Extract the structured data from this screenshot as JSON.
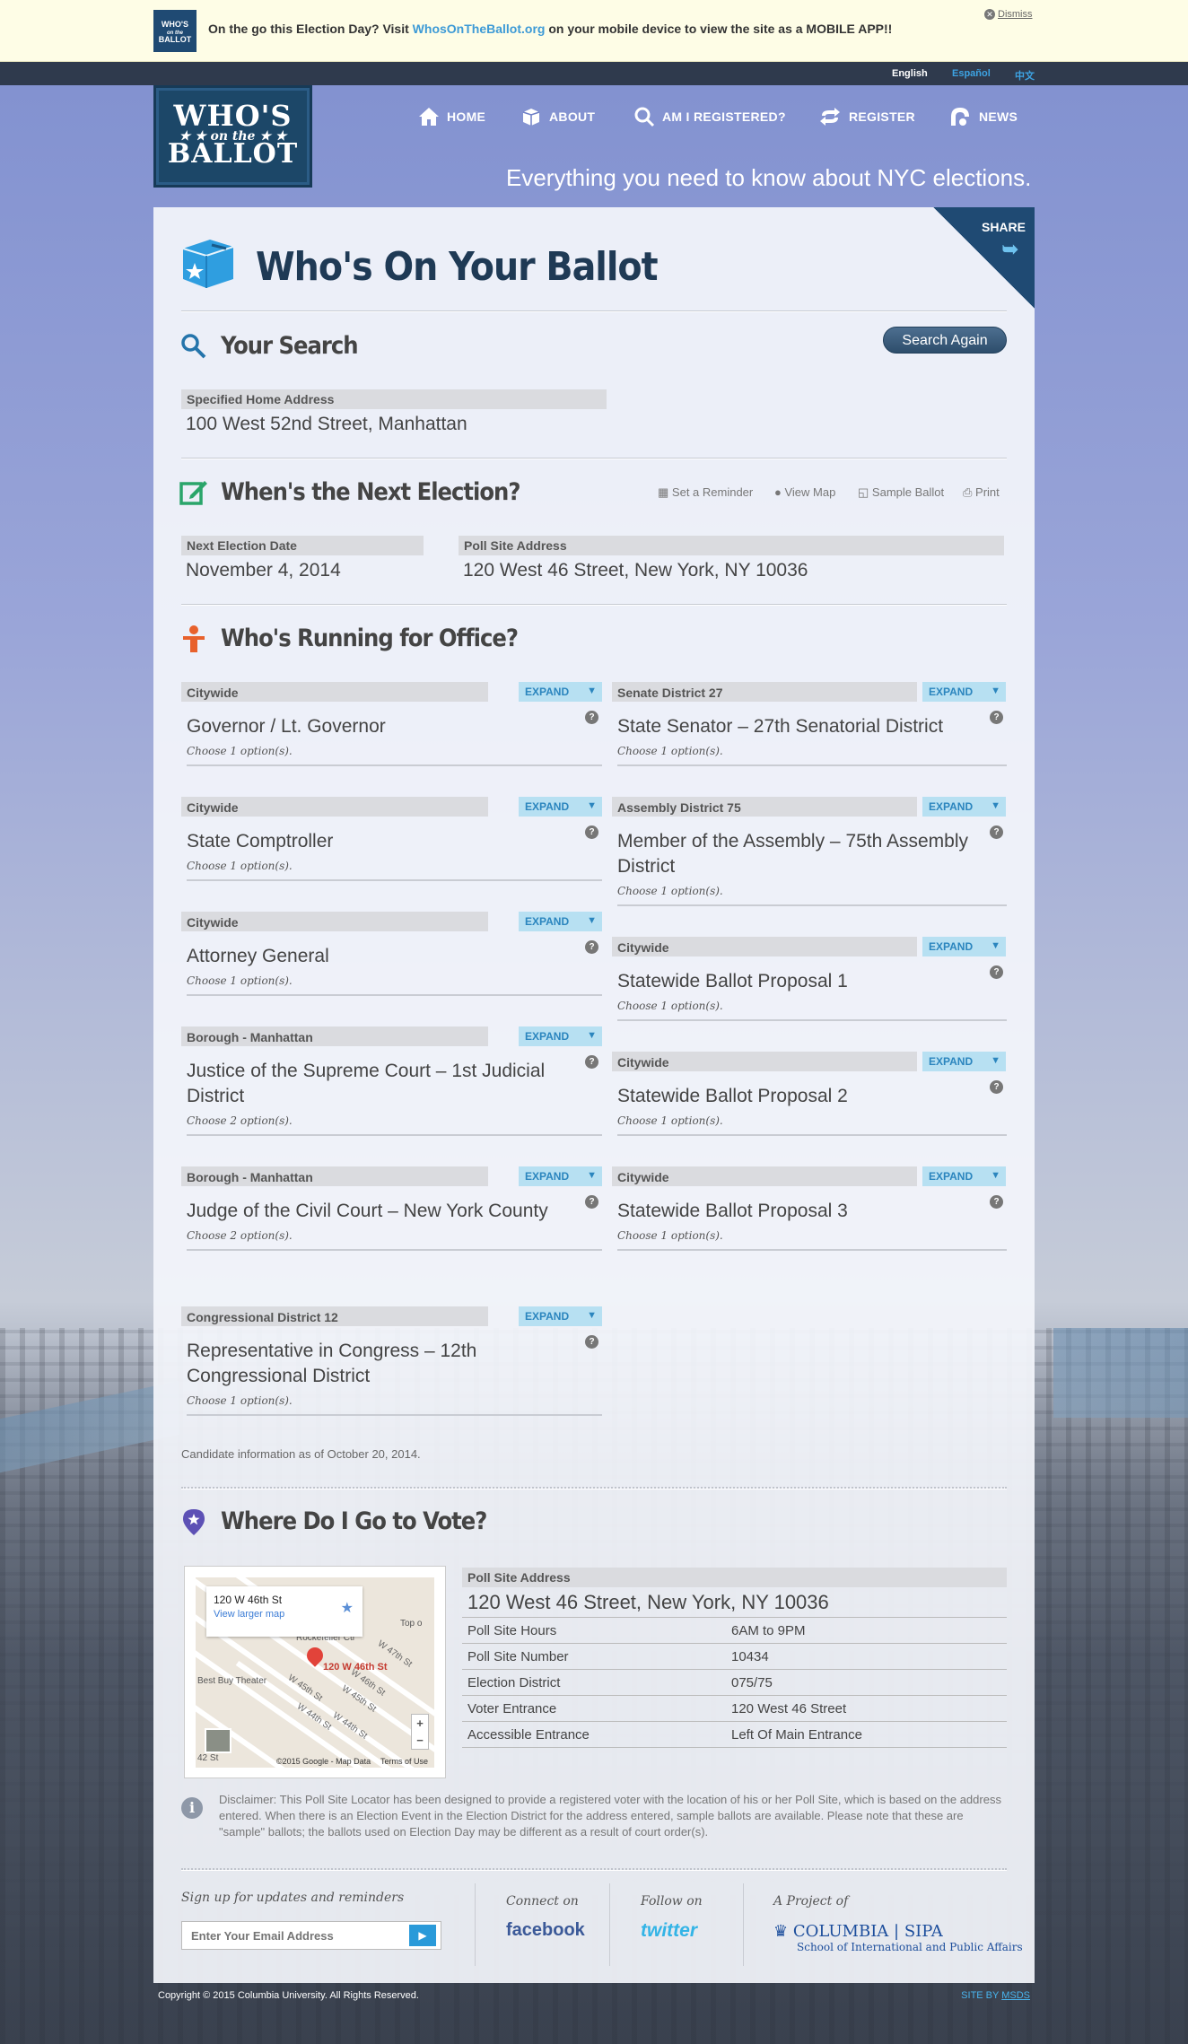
{
  "banner": {
    "logo_text": "WHO'S on the BALLOT",
    "text_before": "On the go this Election Day? Visit ",
    "link": "WhosOnTheBallot.org",
    "text_after": " on your mobile device to view the site as a MOBILE APP!!",
    "dismiss": "Dismiss"
  },
  "languages": {
    "english": "English",
    "spanish": "Español",
    "chinese": "中文"
  },
  "header": {
    "logo_line1": "WHO'S",
    "logo_line2": "on the",
    "logo_line3": "BALLOT",
    "nav": {
      "home": "HOME",
      "about": "ABOUT",
      "registered": "AM I REGISTERED?",
      "register": "REGISTER",
      "news": "NEWS"
    },
    "tagline": "Everything you need to know about NYC elections."
  },
  "share": "SHARE",
  "page_title": "Who's On Your Ballot",
  "search": {
    "heading": "Your Search",
    "button": "Search Again",
    "address_label": "Specified Home Address",
    "address_value": "100 West 52nd Street, Manhattan"
  },
  "next_election": {
    "heading": "When's the Next Election?",
    "tools": {
      "reminder": "Set a Reminder",
      "map": "View Map",
      "sample": "Sample Ballot",
      "print": "Print"
    },
    "date_label": "Next Election Date",
    "date_value": "November 4, 2014",
    "poll_label": "Poll Site Address",
    "poll_value": "120 West 46 Street, New York, NY 10036"
  },
  "running": {
    "heading": "Who's Running for Office?",
    "expand": "EXPAND",
    "left": [
      {
        "district": "Citywide",
        "office": "Governor / Lt. Governor",
        "choose": "Choose 1 option(s)."
      },
      {
        "district": "Citywide",
        "office": "State Comptroller",
        "choose": "Choose 1 option(s)."
      },
      {
        "district": "Citywide",
        "office": "Attorney General",
        "choose": "Choose 1 option(s)."
      },
      {
        "district": "Borough - Manhattan",
        "office": "Justice of the Supreme Court – 1st Judicial District",
        "choose": "Choose 2 option(s)."
      },
      {
        "district": "Borough - Manhattan",
        "office": "Judge of the Civil Court – New York County",
        "choose": "Choose 2 option(s)."
      },
      {
        "district": "Congressional District 12",
        "office": "Representative in Congress – 12th Congressional District",
        "choose": "Choose 1 option(s)."
      }
    ],
    "right": [
      {
        "district": "Senate District 27",
        "office": "State Senator – 27th Senatorial District",
        "choose": "Choose 1 option(s)."
      },
      {
        "district": "Assembly District 75",
        "office": "Member of the Assembly – 75th Assembly District",
        "choose": "Choose 1 option(s)."
      },
      {
        "district": "Citywide",
        "office": "Statewide Ballot Proposal 1",
        "choose": "Choose 1 option(s)."
      },
      {
        "district": "Citywide",
        "office": "Statewide Ballot Proposal 2",
        "choose": "Choose 1 option(s)."
      },
      {
        "district": "Citywide",
        "office": "Statewide Ballot Proposal 3",
        "choose": "Choose 1 option(s)."
      }
    ],
    "as_of": "Candidate information as of October 20, 2014."
  },
  "where": {
    "heading": "Where Do I Go to Vote?",
    "map": {
      "info_title": "120 W 46th St",
      "info_link": "View larger map",
      "pin_label": "120 W 46th St",
      "streets": [
        "W 45th St",
        "W 46th St",
        "W 44th St",
        "W 47th St",
        "W 45th St",
        "W 44th St"
      ],
      "poi": "Best Buy Theater",
      "rock": "Rockefeller Ctr",
      "station": "42 St",
      "credit": "©2015 Google - Map Data",
      "terms": "Terms of Use",
      "top": "Top o"
    },
    "address_label": "Poll Site Address",
    "address_value": "120 West 46 Street, New York, NY 10036",
    "rows": [
      {
        "k": "Poll Site Hours",
        "v": "6AM to 9PM"
      },
      {
        "k": "Poll Site Number",
        "v": "10434"
      },
      {
        "k": "Election District",
        "v": "075/75"
      },
      {
        "k": "Voter Entrance",
        "v": "120 West 46 Street"
      },
      {
        "k": "Accessible Entrance",
        "v": "Left Of Main Entrance"
      }
    ],
    "disclaimer": "Disclaimer: This Poll Site Locator has been designed to provide a registered voter with the location of his or her Poll Site, which is based on the address entered. When there is an Election Event in the Election District for the address entered, sample ballots are available. Please note that these are \"sample\" ballots; the ballots used on Election Day may be different as a result of court order(s)."
  },
  "footer": {
    "signup": "Sign up for updates and reminders",
    "email_placeholder": "Enter Your Email Address",
    "connect": "Connect on",
    "facebook": "facebook",
    "follow": "Follow on",
    "twitter": "twitter",
    "project": "A Project of",
    "columbia": "COLUMBIA | SIPA",
    "school": "School of International and Public Affairs",
    "copyright": "Copyright © 2015 Columbia University. All Rights Reserved.",
    "site_by": "SITE BY",
    "msds": "MSDS"
  }
}
